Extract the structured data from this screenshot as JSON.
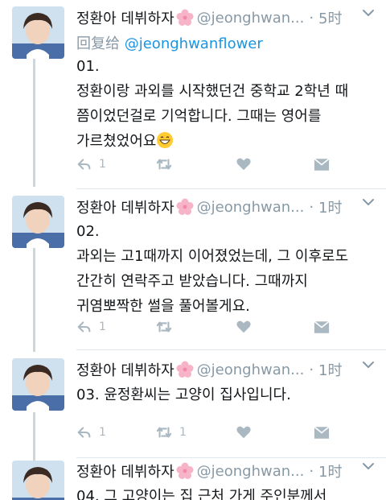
{
  "colors": {
    "link": "#1b95e0",
    "muted": "#8899a6",
    "icon": "#aab8c2",
    "thread": "#ccd6dd"
  },
  "tweets": [
    {
      "name": "정환아 데뷔하자",
      "handle": "@jeonghwan...",
      "time": "5时",
      "reply_prefix": "回复给",
      "reply_mention": "@jeonghwanflower",
      "text": "01.\n정환이랑 과외를 시작했던건 중학교 2학년 때 쯤이었던걸로 기억합니다. 그때는 영어를 가르쳤었어요",
      "emoji": "grinning-face-emoji",
      "reply_count": "1",
      "retweet_count": "",
      "like_count": ""
    },
    {
      "name": "정환아 데뷔하자",
      "handle": "@jeonghwan...",
      "time": "1时",
      "text": "02.\n과외는 고1때까지 이어졌었는데, 그 이후로도 간간히 연락주고 받았습니다. 그때까지 귀염뽀짝한 썰을 풀어볼게요.",
      "reply_count": "1",
      "retweet_count": "",
      "like_count": ""
    },
    {
      "name": "정환아 데뷔하자",
      "handle": "@jeonghwan...",
      "time": "1时",
      "text": "03. 윤정환씨는 고양이 집사입니다.",
      "reply_count": "1",
      "retweet_count": "1",
      "like_count": ""
    },
    {
      "name": "정환아 데뷔하자",
      "handle": "@jeonghwan...",
      "time": "1时",
      "text": "04. 그 고양이는 집 근처 가게 주인분께서"
    }
  ]
}
